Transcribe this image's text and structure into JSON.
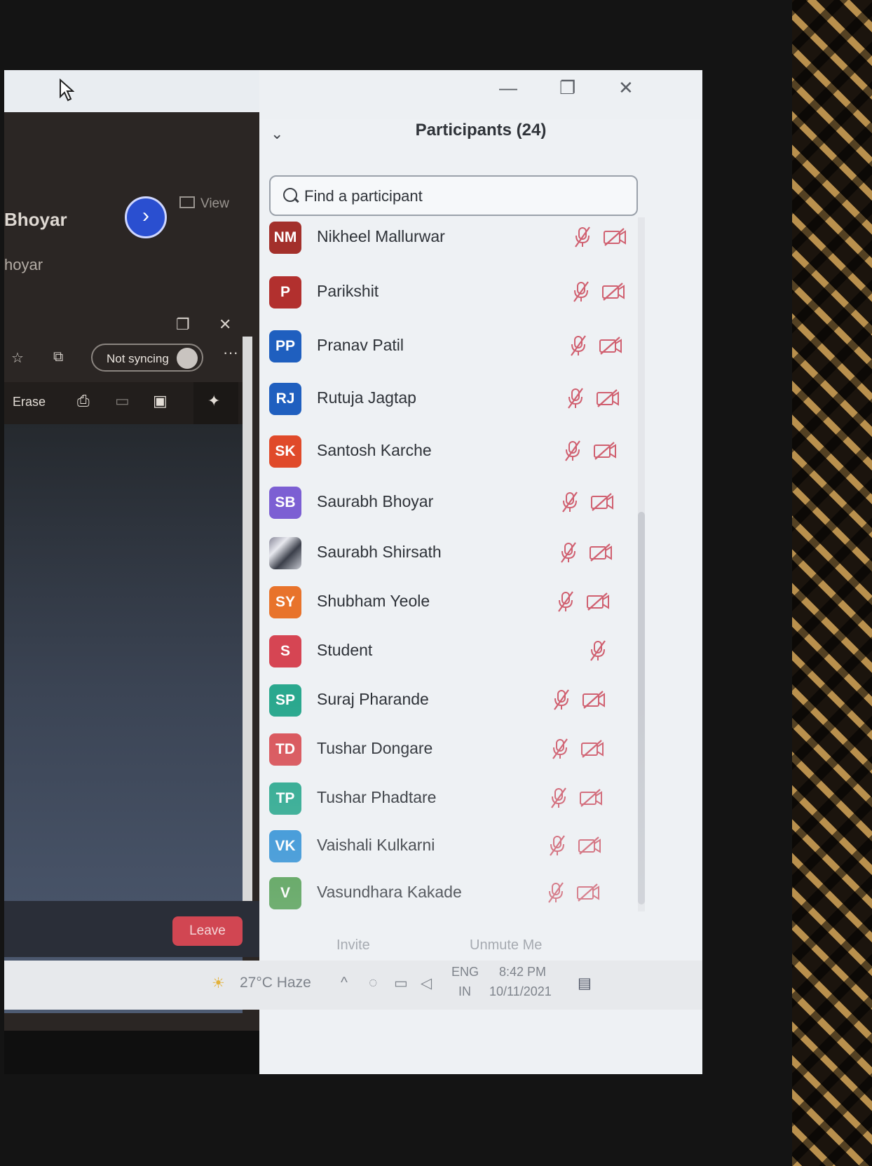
{
  "left_panel": {
    "view_label": "View",
    "presenter_name": "Bhoyar",
    "presenter_sub": "hoyar",
    "not_syncing": "Not syncing",
    "more": "···",
    "erase": "Erase",
    "leave": "Leave"
  },
  "participants": {
    "title": "Participants (24)",
    "search_placeholder": "Find a participant",
    "list": [
      {
        "initials": "NM",
        "name": "Nikheel Mallurwar",
        "color": "#a3302b",
        "video_off": true
      },
      {
        "initials": "P",
        "name": "Parikshit",
        "color": "#b2302e",
        "video_off": true
      },
      {
        "initials": "PP",
        "name": "Pranav Patil",
        "color": "#1f5fbf",
        "video_off": true
      },
      {
        "initials": "RJ",
        "name": "Rutuja Jagtap",
        "color": "#1f5fbf",
        "video_off": true
      },
      {
        "initials": "SK",
        "name": "Santosh Karche",
        "color": "#e04a2a",
        "video_off": true
      },
      {
        "initials": "SB",
        "name": "Saurabh Bhoyar",
        "color": "#7c5fd3",
        "video_off": true
      },
      {
        "initials": "",
        "name": "Saurabh Shirsath",
        "color": "photo",
        "video_off": true
      },
      {
        "initials": "SY",
        "name": "Shubham Yeole",
        "color": "#e8732b",
        "video_off": true
      },
      {
        "initials": "S",
        "name": "Student",
        "color": "#d64553",
        "video_off": false
      },
      {
        "initials": "SP",
        "name": "Suraj Pharande",
        "color": "#2aa88e",
        "video_off": true
      },
      {
        "initials": "TD",
        "name": "Tushar Dongare",
        "color": "#d9545a",
        "video_off": true
      },
      {
        "initials": "TP",
        "name": "Tushar Phadtare",
        "color": "#2aa88e",
        "video_off": true
      },
      {
        "initials": "VK",
        "name": "Vaishali Kulkarni",
        "color": "#2d8fd5",
        "video_off": true
      },
      {
        "initials": "V",
        "name": "Vasundhara Kakade",
        "color": "#4a9a4a",
        "video_off": true
      }
    ],
    "invite": "Invite",
    "unmute": "Unmute Me"
  },
  "taskbar": {
    "weather": "27°C  Haze",
    "lang_top": "ENG",
    "lang_bottom": "IN",
    "time": "8:42 PM",
    "date": "10/11/2021"
  }
}
